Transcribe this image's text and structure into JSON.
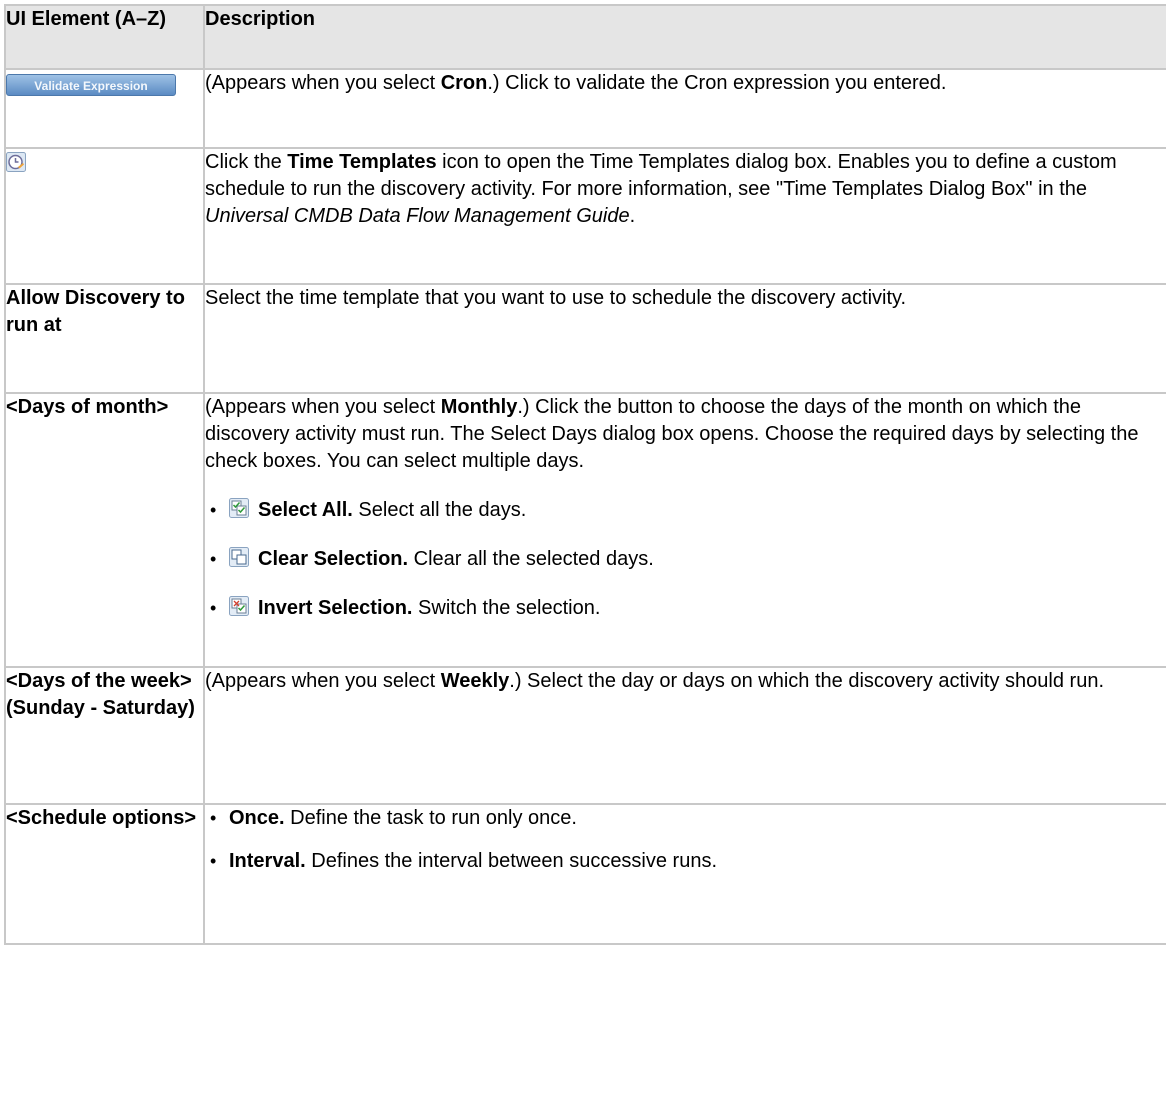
{
  "headers": {
    "element": "UI Element (A–Z)",
    "description": "Description"
  },
  "rows": [
    {
      "validate_button_label": "Validate Expression",
      "desc": [
        "(Appears when you select ",
        "Cron",
        ".) Click to validate the Cron expression you entered."
      ]
    },
    {
      "icon": "time-templates-icon",
      "desc": [
        "Click the ",
        "Time Templates",
        " icon to open the Time Templates dialog box. Enables you to define a custom schedule to run the discovery activity. For more information, see \"Time Templates Dialog Box\" in the ",
        "Universal CMDB Data Flow Management Guide",
        "."
      ]
    },
    {
      "element": "Allow Discovery to run at",
      "desc": "Select the time template that you want to use to schedule the discovery activity."
    },
    {
      "element": "<Days of month>",
      "desc": [
        "(Appears when you select ",
        "Monthly",
        ".) Click the button to choose the days of the month on which the discovery activity must run. The Select Days dialog box opens. Choose the required days by selecting the check boxes. You can select multiple days."
      ],
      "items": [
        {
          "icon": "select-all-icon",
          "label": "Select All.",
          "text": " Select all the days."
        },
        {
          "icon": "clear-selection-icon",
          "label": "Clear Selection.",
          "text": " Clear all the selected days."
        },
        {
          "icon": "invert-selection-icon",
          "label": "Invert Selection.",
          "text": " Switch the selection."
        }
      ]
    },
    {
      "element": "<Days of the week> (Sunday - Saturday)",
      "desc": [
        "(Appears when you select ",
        "Weekly",
        ".) Select the day or days on which the discovery activity should run."
      ]
    },
    {
      "element": "<Schedule options>",
      "items": [
        {
          "label": "Once.",
          "text": " Define the task to run only once."
        },
        {
          "label": "Interval.",
          "text": " Defines the interval between successive runs."
        }
      ]
    }
  ]
}
